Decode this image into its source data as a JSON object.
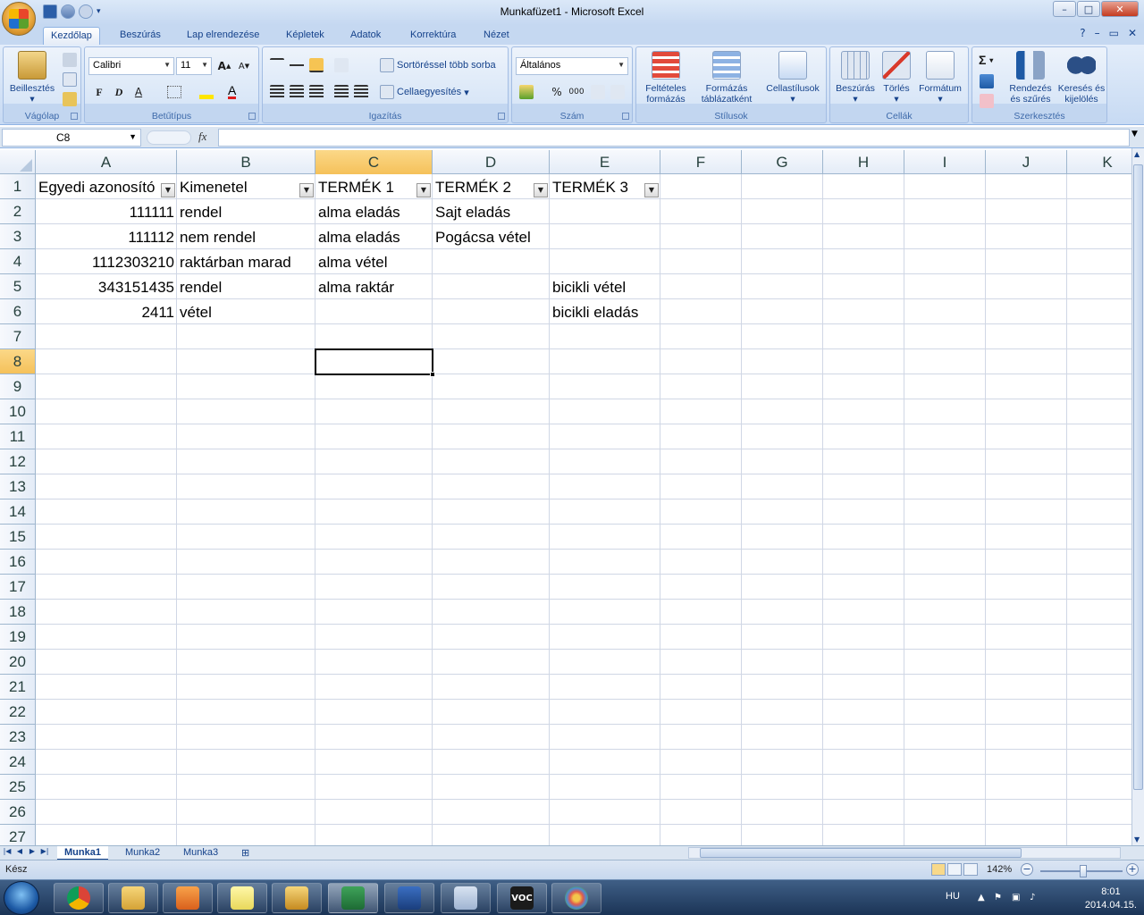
{
  "window": {
    "title": "Munkafüzet1 - Microsoft Excel",
    "min": "–",
    "max": "□",
    "close": "✕"
  },
  "tabs": [
    {
      "label": "Kezdőlap",
      "active": true
    },
    {
      "label": "Beszúrás"
    },
    {
      "label": "Lap elrendezése"
    },
    {
      "label": "Képletek"
    },
    {
      "label": "Adatok"
    },
    {
      "label": "Korrektúra"
    },
    {
      "label": "Nézet"
    }
  ],
  "ribbon": {
    "clipboard": {
      "label": "Vágólap",
      "paste": "Beillesztés"
    },
    "font": {
      "label": "Betűtípus",
      "family": "Calibri",
      "size": "11",
      "bold": "F",
      "italic": "D",
      "underline": "A"
    },
    "alignment": {
      "label": "Igazítás",
      "wrap": "Sortöréssel több sorba",
      "merge": "Cellaegyesítés"
    },
    "number": {
      "label": "Szám",
      "format": "Általános",
      "percent": "%",
      "thousands": "000"
    },
    "styles": {
      "label": "Stílusok",
      "conditional": "Feltételes formázás",
      "table": "Formázás táblázatként",
      "cellstyles": "Cellastílusok"
    },
    "cells": {
      "label": "Cellák",
      "insert": "Beszúrás",
      "delete": "Törlés",
      "format": "Formátum"
    },
    "editing": {
      "label": "Szerkesztés",
      "sort": "Rendezés és szűrés",
      "find": "Keresés és kijelölés",
      "sum": "Σ"
    }
  },
  "formula_bar": {
    "name_box": "C8",
    "fx": "fx",
    "value": ""
  },
  "grid": {
    "columns": [
      "A",
      "B",
      "C",
      "D",
      "E",
      "F",
      "G",
      "H",
      "I",
      "J",
      "K"
    ],
    "rows": [
      "1",
      "2",
      "3",
      "4",
      "5",
      "6",
      "7",
      "8",
      "9",
      "10",
      "11",
      "12",
      "13",
      "14",
      "15",
      "16",
      "17",
      "18",
      "19",
      "20",
      "21",
      "22",
      "23",
      "24",
      "25",
      "26",
      "27"
    ],
    "selected": "C8",
    "headers": [
      "Egyedi azonosító",
      "Kimenetel",
      "TERMÉK 1",
      "TERMÉK 2",
      "TERMÉK 3"
    ],
    "data": [
      [
        "111111",
        "rendel",
        "alma eladás",
        "Sajt eladás",
        ""
      ],
      [
        "111112",
        "nem rendel",
        "alma eladás",
        "Pogácsa vétel",
        ""
      ],
      [
        "1112303210",
        "raktárban marad",
        "alma vétel",
        "",
        ""
      ],
      [
        "343151435",
        "rendel",
        "alma raktár",
        "",
        "bicikli vétel"
      ],
      [
        "2411",
        "vétel",
        "",
        "",
        "bicikli eladás"
      ]
    ]
  },
  "sheets": [
    "Munka1",
    "Munka2",
    "Munka3"
  ],
  "status": {
    "text": "Kész",
    "zoom": "142%"
  },
  "taskbar": {
    "apps": [
      "chrome-icon",
      "explorer-icon",
      "media-icon",
      "notes-icon",
      "outlook-icon",
      "excel-icon",
      "save-icon",
      "calculator-icon",
      "voc-icon",
      "paint-icon"
    ],
    "lang": "HU",
    "time": "8:01",
    "date": "2014.04.15."
  }
}
